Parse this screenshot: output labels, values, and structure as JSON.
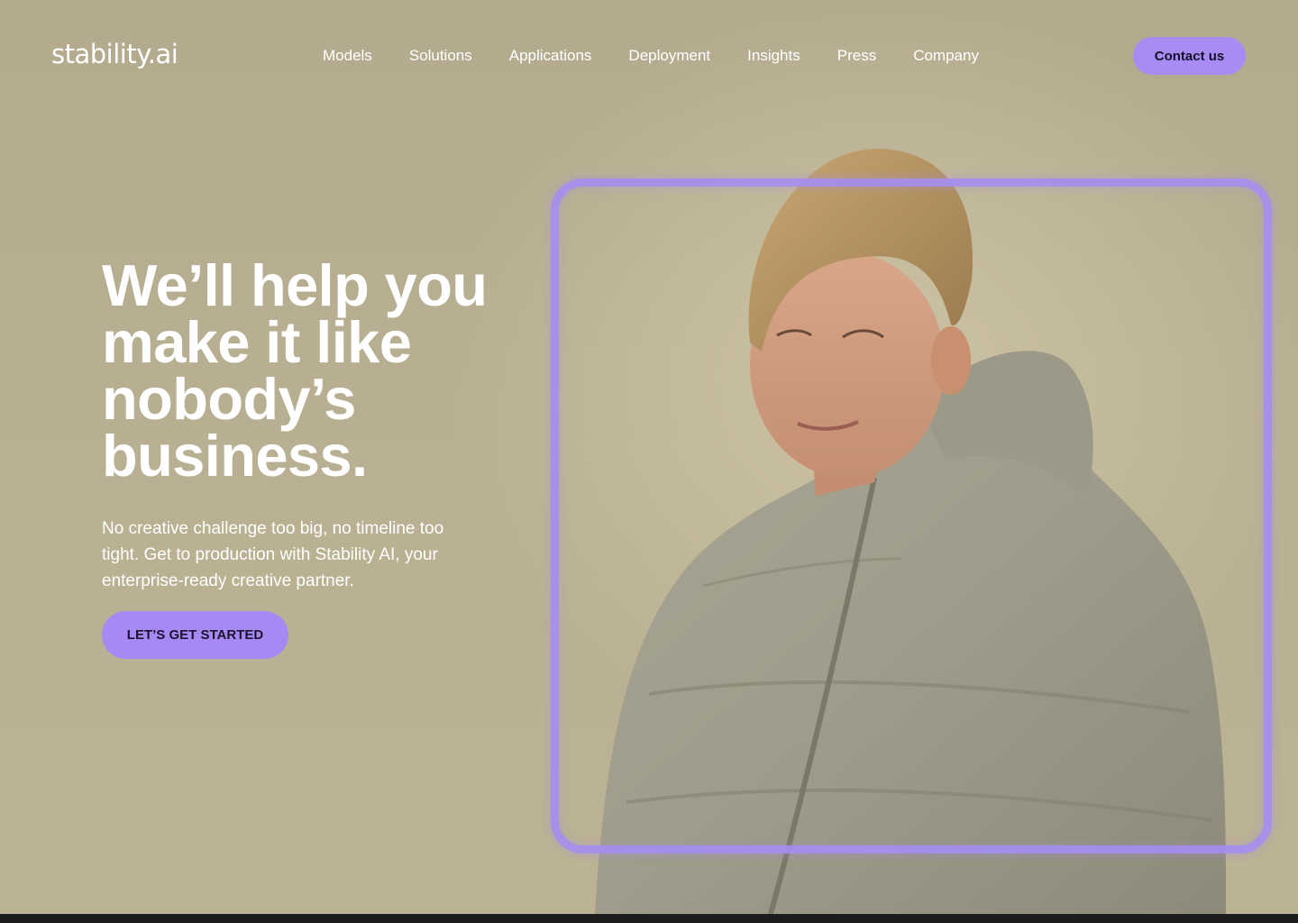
{
  "header": {
    "logo": "stability.ai",
    "nav": [
      "Models",
      "Solutions",
      "Applications",
      "Deployment",
      "Insights",
      "Press",
      "Company"
    ],
    "contact_label": "Contact us"
  },
  "hero": {
    "title": "We’ll help you make it like nobody’s business.",
    "subtitle": "No creative challenge too big, no timeline too tight. Get to production with Stability AI, your enterprise-ready creative partner.",
    "cta_label": "LET’S GET STARTED"
  },
  "colors": {
    "background": "#b8ae92",
    "accent": "#a88cf4",
    "text": "#ffffff",
    "bottom_bar": "#1c1d1f"
  }
}
